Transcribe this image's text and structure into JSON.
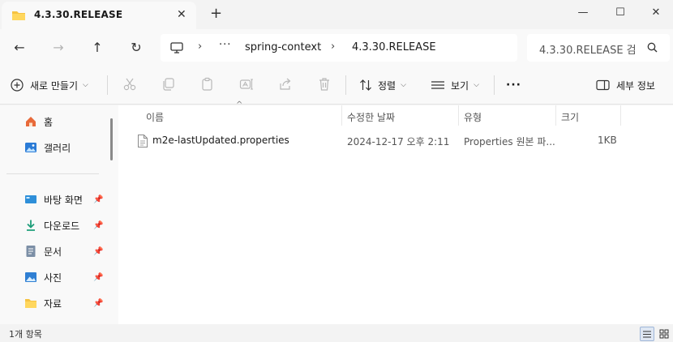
{
  "tab": {
    "title": "4.3.30.RELEASE",
    "folder_icon": "folder-icon",
    "close_label": "✕"
  },
  "window_controls": {
    "new_tab_label": "+",
    "minimize_label": "—",
    "maximize_label": "☐",
    "close_label": "✕"
  },
  "navigation": {
    "back_label": "←",
    "forward_label": "→",
    "up_label": "↑",
    "refresh_label": "↻"
  },
  "address": {
    "overflow_label": "···",
    "separator": "›",
    "crumbs": [
      "spring-context",
      "4.3.30.RELEASE"
    ]
  },
  "search": {
    "text": "4.3.30.RELEASE 검"
  },
  "commandbar": {
    "new_label": "새로 만들기",
    "sort_label": "정렬",
    "view_label": "보기",
    "more_label": "···",
    "details_label": "세부 정보"
  },
  "sidebar": {
    "items": [
      {
        "label": "홈",
        "icon": "home-icon"
      },
      {
        "label": "갤러리",
        "icon": "gallery-icon"
      },
      {
        "label": "바탕 화면",
        "icon": "desktop-icon",
        "pinned": true
      },
      {
        "label": "다운로드",
        "icon": "download-icon",
        "pinned": true
      },
      {
        "label": "문서",
        "icon": "document-icon",
        "pinned": true
      },
      {
        "label": "사진",
        "icon": "pictures-icon",
        "pinned": true
      },
      {
        "label": "자료",
        "icon": "folder-icon",
        "pinned": true
      }
    ]
  },
  "columns": {
    "name": "이름",
    "modified": "수정한 날짜",
    "type": "유형",
    "size": "크기"
  },
  "files": [
    {
      "name": "m2e-lastUpdated.properties",
      "modified": "2024-12-17 오후 2:11",
      "type": "Properties 원본 파...",
      "size": "1KB"
    }
  ],
  "status": {
    "item_count": "1개 항목"
  },
  "colors": {
    "accent": "#0067c0",
    "folder": "#f6c343",
    "background": "#f3f3f3",
    "surface": "#ffffff"
  }
}
